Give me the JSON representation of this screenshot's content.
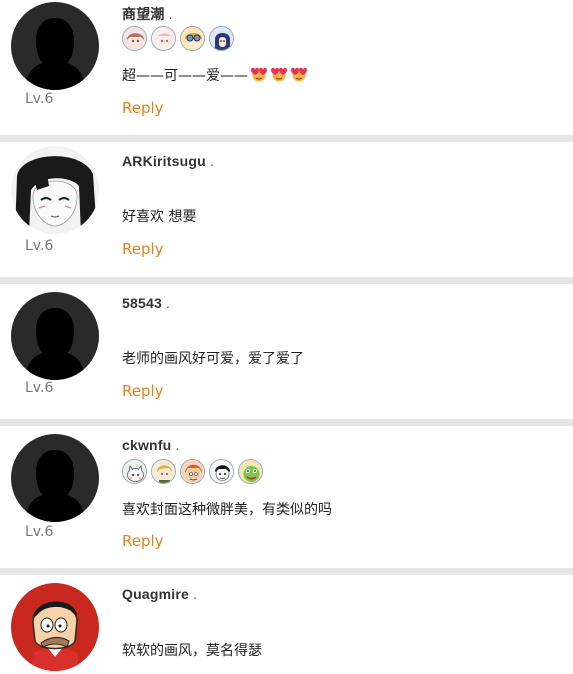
{
  "comments": [
    {
      "username": "商望潮",
      "dot": ".",
      "level": "Lv.6",
      "text": "超——可——爱——",
      "reply": "Reply",
      "badges": [
        "anime-girl-badge",
        "pink-hair-badge",
        "goggles-badge",
        "blue-hair-badge"
      ],
      "emojis": [
        "heart-face-emoji",
        "heart-face-emoji",
        "heart-face-emoji"
      ]
    },
    {
      "username": "ARKiritsugu",
      "dot": ".",
      "level": "Lv.6",
      "text": "好喜欢 想要",
      "reply": "Reply"
    },
    {
      "username": "58543",
      "dot": ".",
      "level": "Lv.6",
      "text": "老师的画风好可爱，爱了爱了",
      "reply": "Reply"
    },
    {
      "username": "ckwnfu",
      "dot": ".",
      "level": "Lv.6",
      "text": "喜欢封面这种微胖美，有类似的吗",
      "reply": "Reply",
      "badges": [
        "cat-badge",
        "blonde-badge",
        "orange-hair-badge",
        "black-hair-badge",
        "green-frog-badge"
      ]
    },
    {
      "username": "Quagmire",
      "dot": ".",
      "text": "软软的画风，莫名得瑟"
    }
  ],
  "colors": {
    "reply": "#e8801a",
    "separator": "#e6e6e6"
  }
}
